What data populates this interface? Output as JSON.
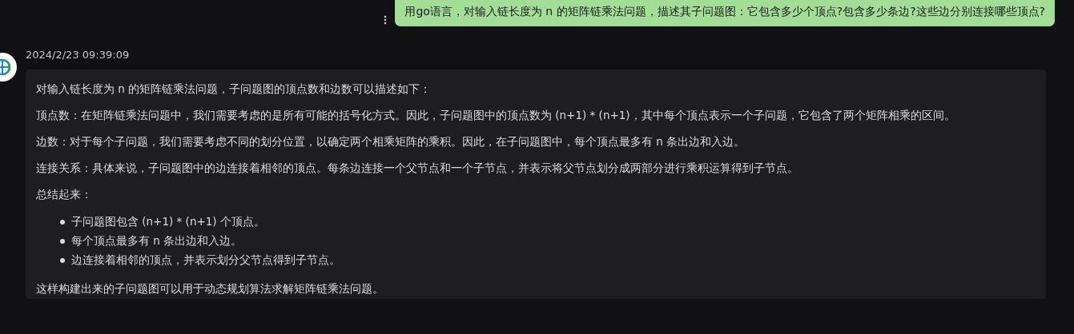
{
  "user_message": {
    "text": "用go语言，对输入链长度为 n 的矩阵链乘法问题，描述其子问题图：它包含多少个顶点?包含多少条边?这些边分别连接哪些顶点?"
  },
  "reply": {
    "timestamp": "2024/2/23 09:39:09",
    "blocks": [
      {
        "kind": "paragraph",
        "text": "对输入链长度为 n 的矩阵链乘法问题，子问题图的顶点数和边数可以描述如下："
      },
      {
        "kind": "paragraph",
        "text": "顶点数：在矩阵链乘法问题中，我们需要考虑的是所有可能的括号化方式。因此，子问题图中的顶点数为 (n+1) * (n+1)，其中每个顶点表示一个子问题，它包含了两个矩阵相乘的区间。"
      },
      {
        "kind": "paragraph",
        "text": "边数：对于每个子问题，我们需要考虑不同的划分位置，以确定两个相乘矩阵的乘积。因此，在子问题图中，每个顶点最多有 n 条出边和入边。"
      },
      {
        "kind": "paragraph",
        "text": "连接关系：具体来说，子问题图中的边连接着相邻的顶点。每条边连接一个父节点和一个子节点，并表示将父节点划分成两部分进行乘积运算得到子节点。"
      },
      {
        "kind": "paragraph",
        "text": "总结起来："
      },
      {
        "kind": "list",
        "items": [
          "子问题图包含 (n+1) * (n+1) 个顶点。",
          "每个顶点最多有 n 条出边和入边。",
          "边连接着相邻的顶点，并表示划分父节点得到子节点。"
        ]
      },
      {
        "kind": "paragraph",
        "text": "这样构建出来的子问题图可以用于动态规划算法求解矩阵链乘法问题。"
      }
    ]
  }
}
